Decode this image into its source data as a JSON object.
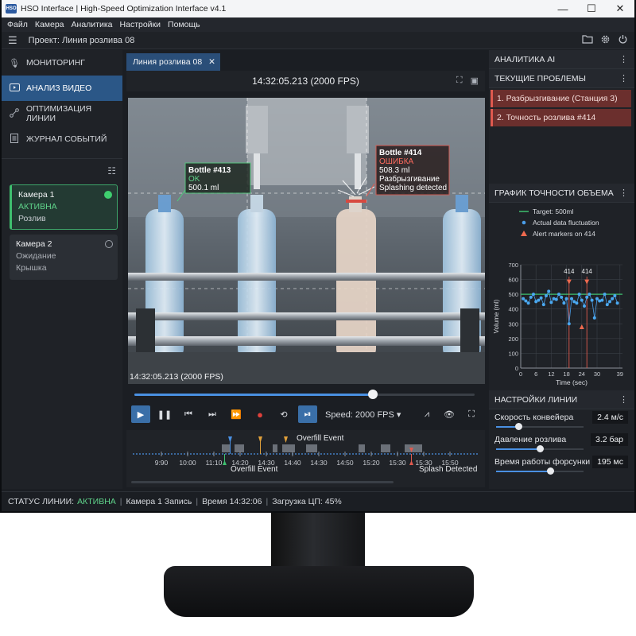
{
  "window": {
    "logo_text": "HSO",
    "title": "HSO Interface | High-Speed Optimization Interface v4.1",
    "controls": [
      "—",
      "☐",
      "✕"
    ]
  },
  "menu": [
    "Файл",
    "Камера",
    "Аналитика",
    "Настройки",
    "Помощь"
  ],
  "project": {
    "label": "Проект: Линия розлива 08"
  },
  "sidebar": {
    "nav": [
      {
        "label": "МОНИТОРИНГ",
        "icon": "microphone-icon"
      },
      {
        "label": "АНАЛИЗ ВИДЕО",
        "icon": "video-icon",
        "active": true
      },
      {
        "label": "ОПТИМИЗАЦИЯ ЛИНИИ",
        "icon": "flow-icon"
      },
      {
        "label": "ЖУРНАЛ СОБЫТИЙ",
        "icon": "document-icon"
      }
    ],
    "cameras": [
      {
        "name": "Камера 1",
        "status": "АКТИВНА",
        "task": "Розлив"
      },
      {
        "name": "Камера 2",
        "status": "Ожидание",
        "task": "Крышка"
      }
    ]
  },
  "video": {
    "tab_label": "Линия розлива 08",
    "header_time": "14:32:05.213 (2000 FPS)",
    "overlay_time": "14:32:05.213 (2000 FPS)",
    "progress": 0.7,
    "bottle_413": {
      "title": "Bottle #413",
      "status": "OK",
      "volume": "500.1 ml"
    },
    "bottle_414": {
      "title": "Bottle #414",
      "status": "ОШИБКА",
      "volume": "508.3 ml",
      "issue_ru": "Разбрызгивание",
      "issue_en": "Splashing detected"
    },
    "speed_label": "Speed: 2000 FPS"
  },
  "timeline": {
    "ticks": [
      "9:90",
      "10:00",
      "11:10",
      "14:20",
      "14:30",
      "14:40",
      "14:30",
      "14:50",
      "15:20",
      "15:30",
      "15:30",
      "15:50"
    ],
    "events_top": "Overfill Event",
    "events_bottom": "Overfill Event",
    "splash": "Splash Detected"
  },
  "ai": {
    "title": "АНАЛИТИКА AI",
    "issues_title": "ТЕКУЩИЕ ПРОБЛЕМЫ",
    "issues": [
      "1. Разбрызгивание (Станция 3)",
      "2. Точность розлива #414"
    ]
  },
  "chart_data": {
    "type": "scatter",
    "title": "ГРАФИК ТОЧНОСТИ ОБЪЕМА",
    "xlabel": "Time (sec)",
    "ylabel": "Volume (ml)",
    "xlim": [
      0,
      40
    ],
    "ylim": [
      0,
      700
    ],
    "x_ticks": [
      0,
      6,
      12,
      18,
      24,
      30,
      39
    ],
    "y_ticks": [
      0,
      100,
      200,
      300,
      400,
      500,
      600,
      700
    ],
    "target": 500,
    "legend": [
      "Target: 500ml",
      "Actual data fluctuation",
      "Alert markers on 414"
    ],
    "series": [
      {
        "name": "Actual data fluctuation",
        "x": [
          1,
          2,
          3,
          4,
          5,
          6,
          7,
          8,
          9,
          10,
          11,
          12,
          13,
          14,
          15,
          16,
          17,
          18,
          19,
          20,
          21,
          22,
          23,
          24,
          25,
          26,
          27,
          28,
          29,
          30,
          31,
          32,
          33,
          34,
          35,
          36,
          37,
          38
        ],
        "y": [
          470,
          455,
          440,
          480,
          500,
          450,
          460,
          475,
          430,
          490,
          520,
          445,
          470,
          465,
          500,
          480,
          440,
          470,
          300,
          470,
          450,
          440,
          500,
          460,
          420,
          480,
          500,
          460,
          340,
          470,
          455,
          460,
          500,
          430,
          450,
          470,
          490,
          440
        ]
      }
    ],
    "alerts": [
      {
        "x": 19,
        "label": "414"
      },
      {
        "x": 26,
        "label": "414"
      }
    ],
    "low_alert": {
      "x": 24,
      "y": 280
    }
  },
  "settings": {
    "title": "НАСТРОЙКИ ЛИНИИ",
    "rows": [
      {
        "label": "Скорость конвейера",
        "value": "2.4 м/с",
        "level": 0.25
      },
      {
        "label": "Давление розлива",
        "value": "3.2 бар",
        "level": 0.5
      },
      {
        "label": "Время работы форсунки",
        "value": "195 мс",
        "level": 0.62
      }
    ]
  },
  "status": {
    "label": "СТАТУС ЛИНИИ:",
    "state": "АКТИВНА",
    "camera": "Камера 1 Запись",
    "time": "Время 14:32:06",
    "cpu": "Загрузка ЦП: 45%"
  }
}
